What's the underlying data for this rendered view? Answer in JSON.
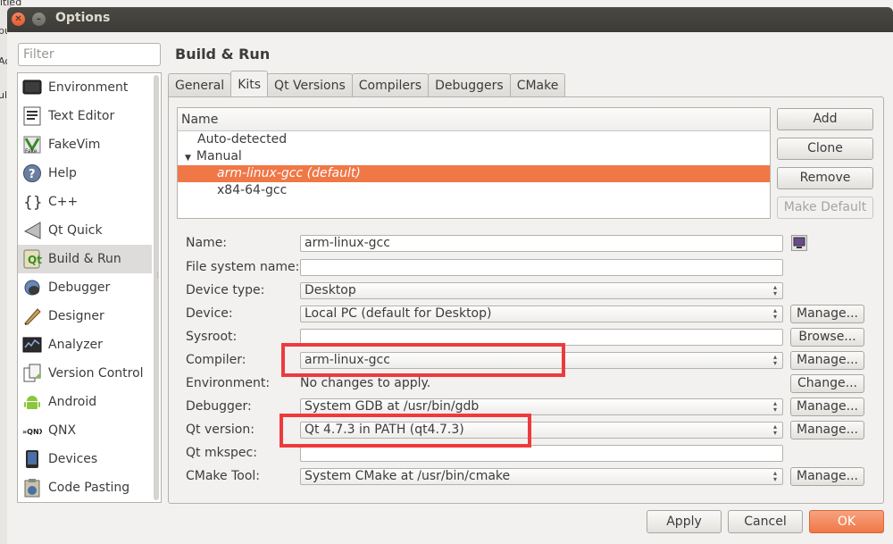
{
  "window": {
    "title": "Options"
  },
  "background": {
    "top_text": "itled",
    "left_texts": [
      "pu",
      "Ac",
      "ul"
    ]
  },
  "sidebar": {
    "filter_placeholder": "Filter",
    "items": [
      {
        "label": "Environment",
        "icon": "monitor-icon",
        "selected": false
      },
      {
        "label": "Text Editor",
        "icon": "text-document-icon",
        "selected": false
      },
      {
        "label": "FakeVim",
        "icon": "fakevim-icon",
        "selected": false
      },
      {
        "label": "Help",
        "icon": "help-icon",
        "selected": false
      },
      {
        "label": "C++",
        "icon": "braces-icon",
        "selected": false
      },
      {
        "label": "Qt Quick",
        "icon": "qt-quick-icon",
        "selected": false
      },
      {
        "label": "Build & Run",
        "icon": "build-run-icon",
        "selected": true
      },
      {
        "label": "Debugger",
        "icon": "bug-icon",
        "selected": false
      },
      {
        "label": "Designer",
        "icon": "designer-icon",
        "selected": false
      },
      {
        "label": "Analyzer",
        "icon": "analyzer-icon",
        "selected": false
      },
      {
        "label": "Version Control",
        "icon": "version-control-icon",
        "selected": false
      },
      {
        "label": "Android",
        "icon": "android-icon",
        "selected": false
      },
      {
        "label": "QNX",
        "icon": "qnx-icon",
        "selected": false
      },
      {
        "label": "Devices",
        "icon": "device-icon",
        "selected": false
      },
      {
        "label": "Code Pasting",
        "icon": "code-pasting-icon",
        "selected": false
      }
    ]
  },
  "main": {
    "heading": "Build & Run",
    "tabs": [
      "General",
      "Kits",
      "Qt Versions",
      "Compilers",
      "Debuggers",
      "CMake"
    ],
    "active_tab": "Kits",
    "kits": {
      "header": "Name",
      "auto_detected": "Auto-detected",
      "manual": "Manual",
      "items": [
        "arm-linux-gcc (default)",
        "x84-64-gcc"
      ],
      "selected_index": 0
    },
    "buttons": {
      "add": "Add",
      "clone": "Clone",
      "remove": "Remove",
      "make_default": "Make Default"
    },
    "form": {
      "name_label": "Name:",
      "name_value": "arm-linux-gcc",
      "fs_label": "File system name:",
      "fs_value": "",
      "device_type_label": "Device type:",
      "device_type_value": "Desktop",
      "device_label": "Device:",
      "device_value": "Local PC (default for Desktop)",
      "sysroot_label": "Sysroot:",
      "sysroot_value": "",
      "compiler_label": "Compiler:",
      "compiler_value": "arm-linux-gcc",
      "environment_label": "Environment:",
      "environment_value": "No changes to apply.",
      "debugger_label": "Debugger:",
      "debugger_value": "System GDB at /usr/bin/gdb",
      "qt_label": "Qt version:",
      "qt_value": "Qt 4.7.3 in PATH (qt4.7.3)",
      "mkspec_label": "Qt mkspec:",
      "mkspec_value": "",
      "cmake_label": "CMake Tool:",
      "cmake_value": "System CMake at /usr/bin/cmake",
      "manage": "Manage...",
      "browse": "Browse...",
      "change": "Change..."
    }
  },
  "footer": {
    "apply": "Apply",
    "cancel": "Cancel",
    "ok": "OK"
  },
  "colors": {
    "accent": "#f07746",
    "highlight_box": "#ee3a3c",
    "titlebar": "#3c3b37"
  }
}
